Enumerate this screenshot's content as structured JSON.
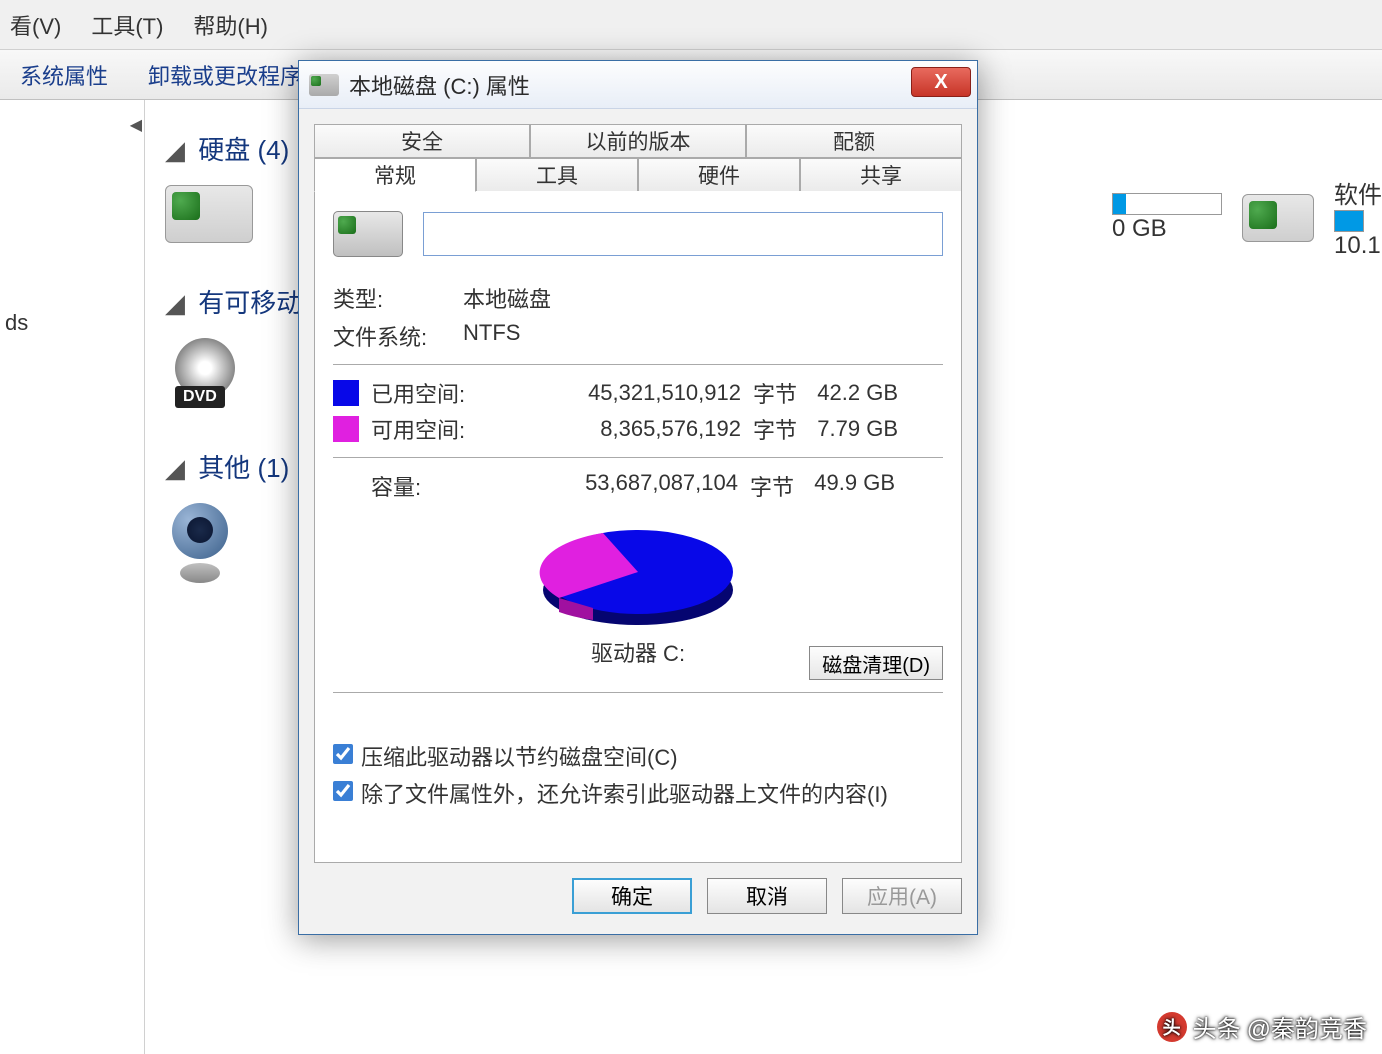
{
  "menubar": {
    "view": "看(V)",
    "tools": "工具(T)",
    "help": "帮助(H)"
  },
  "toolbar": {
    "sysprops": "系统属性",
    "uninstall": "卸载或更改程序"
  },
  "sidebar": {
    "item1": "ds"
  },
  "sections": {
    "hdd": "硬盘 (4)",
    "removable": "有可移动",
    "other": "其他 (1)"
  },
  "bg_drive": {
    "gb": "0 GB",
    "soft": "软件",
    "val": "10.1"
  },
  "dialog": {
    "title": "本地磁盘 (C:) 属性",
    "close": "X",
    "tabs": {
      "security": "安全",
      "prev": "以前的版本",
      "quota": "配额",
      "general": "常规",
      "tools": "工具",
      "hardware": "硬件",
      "sharing": "共享"
    },
    "name_value": "",
    "type_label": "类型:",
    "type_value": "本地磁盘",
    "fs_label": "文件系统:",
    "fs_value": "NTFS",
    "used_label": "已用空间:",
    "used_bytes": "45,321,510,912",
    "used_unit": "字节",
    "used_gb": "42.2 GB",
    "free_label": "可用空间:",
    "free_bytes": "8,365,576,192",
    "free_unit": "字节",
    "free_gb": "7.79 GB",
    "cap_label": "容量:",
    "cap_bytes": "53,687,087,104",
    "cap_unit": "字节",
    "cap_gb": "49.9 GB",
    "drive_label": "驱动器 C:",
    "cleanup": "磁盘清理(D)",
    "compress": "压缩此驱动器以节约磁盘空间(C)",
    "index": "除了文件属性外，还允许索引此驱动器上文件的内容(I)",
    "ok": "确定",
    "cancel": "取消",
    "apply": "应用(A)"
  },
  "watermark": {
    "prefix": "头条",
    "name": "@秦韵竞香"
  },
  "chart_data": {
    "type": "pie",
    "title": "驱动器 C:",
    "series": [
      {
        "name": "已用空间",
        "value": 45321510912,
        "display": "42.2 GB",
        "color": "#0808e8"
      },
      {
        "name": "可用空间",
        "value": 8365576192,
        "display": "7.79 GB",
        "color": "#e020e0"
      }
    ],
    "total": {
      "name": "容量",
      "value": 53687087104,
      "display": "49.9 GB"
    }
  }
}
